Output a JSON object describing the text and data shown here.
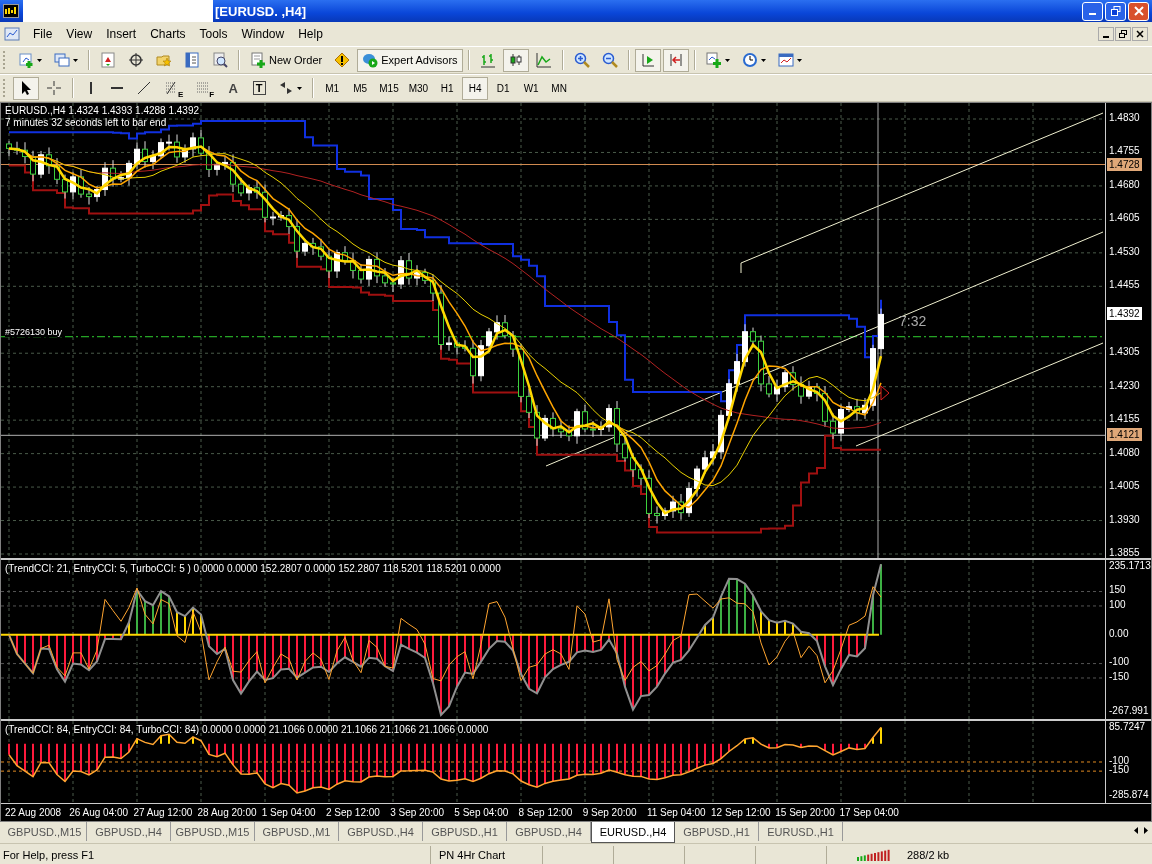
{
  "window": {
    "title": "[EURUSD. ,H4]"
  },
  "menu": [
    "File",
    "View",
    "Insert",
    "Charts",
    "Tools",
    "Window",
    "Help"
  ],
  "toolbar_rows": [
    [
      [
        {
          "kind": "new-chart",
          "pressed": false
        },
        {
          "kind": "profiles",
          "pressed": false
        }
      ],
      [
        {
          "kind": "market-watch",
          "pressed": false
        },
        {
          "kind": "navigator",
          "pressed": false
        },
        {
          "kind": "favorites",
          "pressed": false
        },
        {
          "kind": "terminal",
          "pressed": false
        },
        {
          "kind": "tester",
          "pressed": false
        }
      ],
      [
        {
          "kind": "new-order",
          "label": "New Order",
          "pressed": false
        },
        {
          "kind": "alert",
          "pressed": false
        },
        {
          "kind": "expert-advisors",
          "label": "Expert Advisors",
          "pressed": true
        }
      ],
      [
        {
          "kind": "bar-chart",
          "pressed": false
        },
        {
          "kind": "candle-chart",
          "pressed": true
        },
        {
          "kind": "line-chart",
          "pressed": false
        }
      ],
      [
        {
          "kind": "zoom-in",
          "pressed": false
        },
        {
          "kind": "zoom-out",
          "pressed": false
        }
      ],
      [
        {
          "kind": "auto-scroll",
          "pressed": true
        },
        {
          "kind": "chart-shift",
          "pressed": true
        }
      ],
      [
        {
          "kind": "indicators",
          "pressed": false
        },
        {
          "kind": "periods",
          "pressed": false
        },
        {
          "kind": "templates",
          "pressed": false
        }
      ]
    ],
    [
      [
        {
          "kind": "cursor",
          "pressed": true
        },
        {
          "kind": "crosshair",
          "pressed": false
        }
      ],
      [
        {
          "kind": "vertical-line",
          "pressed": false
        },
        {
          "kind": "horizontal-line",
          "pressed": false
        },
        {
          "kind": "trend-line",
          "pressed": false
        },
        {
          "kind": "fibo",
          "label": "E",
          "pressed": false
        },
        {
          "kind": "fibo-grid",
          "label": "F",
          "pressed": false
        },
        {
          "kind": "text",
          "label": "A",
          "pressed": false
        },
        {
          "kind": "text-label",
          "label": "T",
          "pressed": false
        },
        {
          "kind": "arrows",
          "pressed": false
        }
      ],
      [
        {
          "kind": "timeframe",
          "label": "M1",
          "pressed": false
        },
        {
          "kind": "timeframe",
          "label": "M5",
          "pressed": false
        },
        {
          "kind": "timeframe",
          "label": "M15",
          "pressed": false
        },
        {
          "kind": "timeframe",
          "label": "M30",
          "pressed": false
        },
        {
          "kind": "timeframe",
          "label": "H1",
          "pressed": false
        },
        {
          "kind": "timeframe",
          "label": "H4",
          "pressed": true
        },
        {
          "kind": "timeframe",
          "label": "D1",
          "pressed": false
        },
        {
          "kind": "timeframe",
          "label": "W1",
          "pressed": false
        },
        {
          "kind": "timeframe",
          "label": "MN",
          "pressed": false
        }
      ]
    ]
  ],
  "chart": {
    "symbol_info": "EURUSD.,H4  1.4324 1.4393 1.4288 1.4392",
    "timer": "7 minutes 32 seconds left to bar end",
    "order_label": "#5726130 buy",
    "countdown": "7:32",
    "price_axis": [
      "1.4830",
      "1.4755",
      "1.4680",
      "1.4605",
      "1.4530",
      "1.4455",
      "1.4305",
      "1.4230",
      "1.4155",
      "1.4080",
      "1.4005",
      "1.3930",
      "1.3855"
    ],
    "price_tags": [
      {
        "text": "1.4728",
        "kind": "level"
      },
      {
        "text": "1.4392",
        "kind": "bid"
      },
      {
        "text": "1.4121",
        "kind": "level"
      }
    ]
  },
  "indicators": [
    {
      "legend": "(TrendCCI: 21, EntryCCI: 5, TurboCCI: 5 )  0.0000 0.0000 152.2807 0.0000 152.2807 118.5201 118.5201 0.0000",
      "axis": [
        "235.1713",
        "150",
        "100",
        "0.00",
        "-100",
        "-150",
        "-267.991"
      ]
    },
    {
      "legend": "(TrendCCI: 84, EntryCCI: 84, TurboCCI: 84)  0.0000 0.0000 21.1066 0.0000 21.1066 21.1066 21.1066 0.0000",
      "axis": [
        "85.7247",
        "-100",
        "-150",
        "-285.874"
      ]
    }
  ],
  "time_axis": [
    "22 Aug 2008",
    "26 Aug 04:00",
    "27 Aug 12:00",
    "28 Aug 20:00",
    "1 Sep 04:00",
    "2 Sep 12:00",
    "3 Sep 20:00",
    "5 Sep 04:00",
    "8 Sep 12:00",
    "9 Sep 20:00",
    "11 Sep 04:00",
    "12 Sep 12:00",
    "15 Sep 20:00",
    "17 Sep 04:00"
  ],
  "tabs": [
    {
      "label": "GBPUSD.,M15",
      "selected": false
    },
    {
      "label": "GBPUSD.,H4",
      "selected": false
    },
    {
      "label": "GBPUSD.,M15",
      "selected": false
    },
    {
      "label": "GBPUSD.,M1",
      "selected": false
    },
    {
      "label": "GBPUSD.,H4",
      "selected": false
    },
    {
      "label": "GBPUSD.,H1",
      "selected": false
    },
    {
      "label": "GBPUSD.,H4",
      "selected": false
    },
    {
      "label": "EURUSD.,H4",
      "selected": true
    },
    {
      "label": "GBPUSD.,H1",
      "selected": false
    },
    {
      "label": "EURUSD.,H1",
      "selected": false
    }
  ],
  "status_bar": {
    "help": "For Help, press F1",
    "profile": "PN 4Hr Chart",
    "traffic": "288/2 kb"
  }
}
